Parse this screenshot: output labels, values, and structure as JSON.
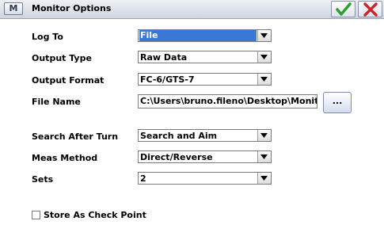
{
  "window": {
    "title": "Monitor Options",
    "icon_letter": "M",
    "accept_icon": "check-icon",
    "cancel_icon": "close-icon"
  },
  "form": {
    "log_to": {
      "label": "Log To",
      "value": "File"
    },
    "output_type": {
      "label": "Output Type",
      "value": "Raw Data"
    },
    "output_format": {
      "label": "Output Format",
      "value": "FC-6/GTS-7"
    },
    "file_name": {
      "label": "File Name",
      "value": "C:\\Users\\bruno.fileno\\Desktop\\Monitor.g",
      "browse_label": "..."
    },
    "search_after_turn": {
      "label": "Search After Turn",
      "value": "Search and Aim"
    },
    "meas_method": {
      "label": "Meas Method",
      "value": "Direct/Reverse"
    },
    "sets": {
      "label": "Sets",
      "value": "2"
    },
    "store_check_point": {
      "label": "Store As Check Point",
      "checked": false
    }
  },
  "colors": {
    "selection": "#3a78d6",
    "accept_green": "#2e9e2e",
    "cancel_red": "#c8282d"
  }
}
